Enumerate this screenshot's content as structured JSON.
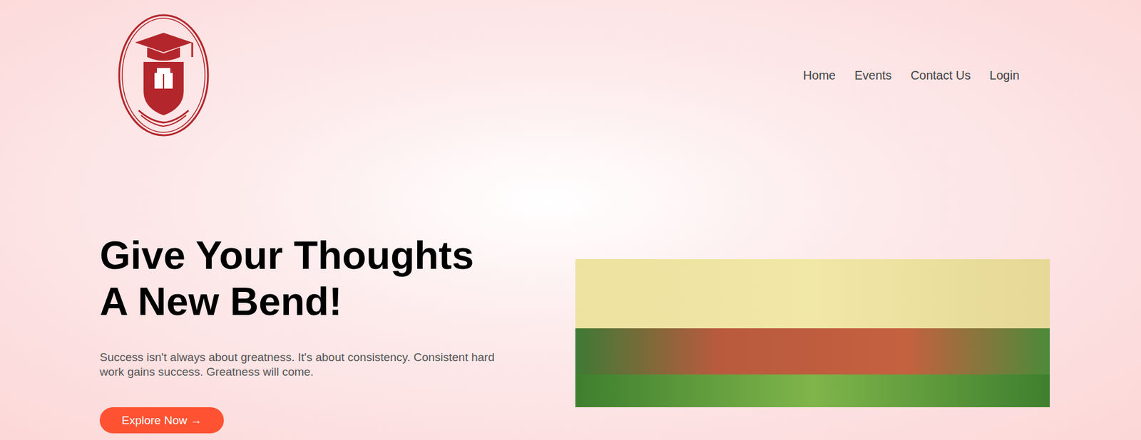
{
  "nav": {
    "links": [
      "Home",
      "Events",
      "Contact Us",
      "Login"
    ]
  },
  "hero": {
    "title_lines": [
      "Give Your Thoughts",
      "A New Bend!"
    ],
    "text": "Success isn't always about greatness. It's about consistency. Consistent hard work gains success. Greatness will come.",
    "button": "Explore Now →"
  }
}
